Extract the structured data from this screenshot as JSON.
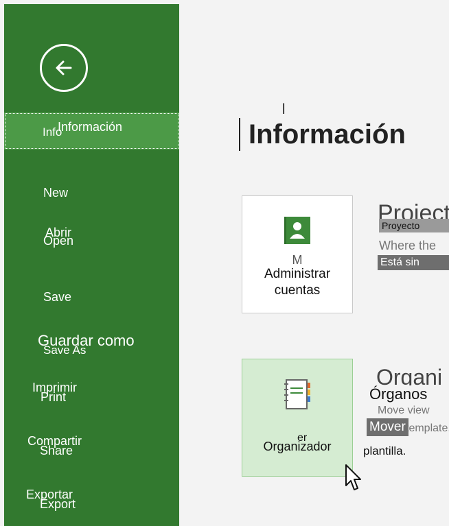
{
  "sidebar": {
    "back_icon": "back-arrow-icon",
    "items": [
      {
        "label": "Información",
        "ghost": "Info"
      },
      {
        "label": "New",
        "ghost": ""
      },
      {
        "label": "Abrir",
        "ghost": "Open"
      },
      {
        "label": "Save",
        "ghost": ""
      },
      {
        "label": "Guardar como",
        "ghost": "Save As"
      },
      {
        "label": "Imprimir",
        "ghost": "Print"
      },
      {
        "label": "Compartir",
        "ghost": "Share"
      },
      {
        "label": "Exportar",
        "ghost": "Export"
      }
    ],
    "active_color": "#4c9a47",
    "bg_color": "#32792f"
  },
  "main": {
    "title": "Información",
    "title_fragment": "I",
    "accounts_tile": {
      "icon": "contact-card-icon",
      "label_line1": "Administrar",
      "label_line2": "cuentas",
      "ghost_fragment": "M"
    },
    "project_section": {
      "heading_ghost": "Project",
      "badge": "Proyecto",
      "ghost_line": "Where the",
      "status_badge": "Está sin"
    },
    "organizer_tile": {
      "icon": "notebook-icon",
      "label": "Organizador",
      "ghost_fragment": "er"
    },
    "organizer_section": {
      "heading_ghost": "Organi",
      "heading": "Órganos",
      "ghost_line1": "Move view",
      "ghost_line2": "template.",
      "badge": "Mover",
      "desc": "plantilla."
    }
  },
  "cursor_icon": "mouse-pointer-icon"
}
